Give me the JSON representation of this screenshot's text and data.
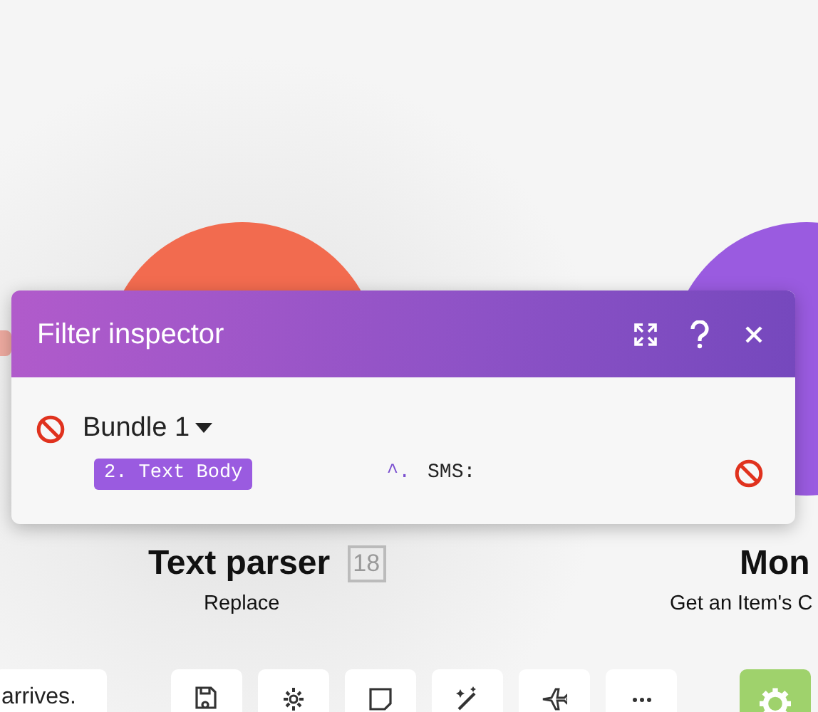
{
  "modules": [
    {
      "title": "Text parser",
      "count": "18",
      "subtitle": "Replace",
      "color": "#f26b4f"
    },
    {
      "title": "Mon",
      "subtitle": "Get an Item's C",
      "color": "#9a5be0"
    }
  ],
  "filter_inspector": {
    "title": "Filter inspector",
    "bundle": "Bundle 1",
    "token": "2. Text Body",
    "operator": "^.",
    "value": "SMS:"
  },
  "toolbar": {
    "note": "arrives.",
    "tools": [
      {
        "kind": "save"
      },
      {
        "kind": "settings"
      },
      {
        "kind": "note"
      },
      {
        "kind": "magic"
      },
      {
        "kind": "plane"
      },
      {
        "kind": "more"
      },
      {
        "kind": "run"
      }
    ]
  }
}
